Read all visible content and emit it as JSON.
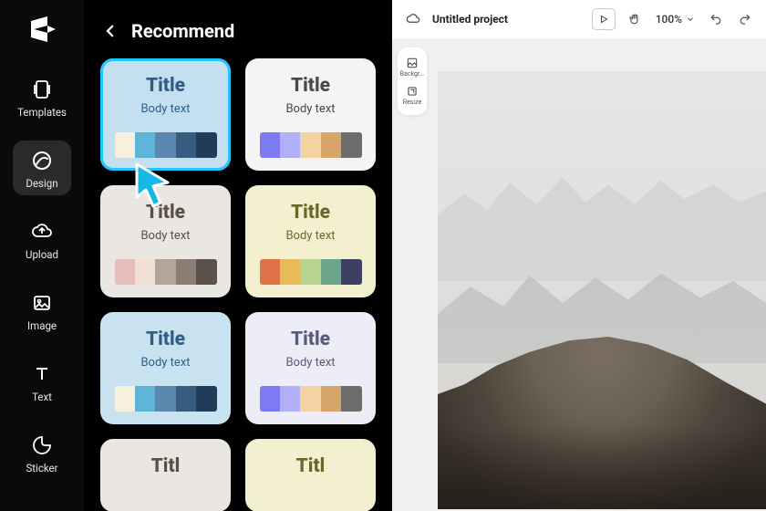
{
  "sidebar": {
    "items": [
      {
        "label": "Templates"
      },
      {
        "label": "Design"
      },
      {
        "label": "Upload"
      },
      {
        "label": "Image"
      },
      {
        "label": "Text"
      },
      {
        "label": "Sticker"
      }
    ]
  },
  "panel": {
    "title": "Recommend",
    "cards": [
      {
        "title": "Title",
        "body": "Body text",
        "bg": "#c4dfef",
        "title_color": "#2f5d87",
        "body_color": "#2f5d87",
        "swatches": [
          "#f6efdb",
          "#5eb3d8",
          "#5a87ae",
          "#385c7d",
          "#1f3d58"
        ]
      },
      {
        "title": "Title",
        "body": "Body text",
        "bg": "#f4f4f4",
        "title_color": "#4a4846",
        "body_color": "#4a4846",
        "swatches": [
          "#7d7af5",
          "#b2b0f9",
          "#f3d2a4",
          "#d6a56a",
          "#6c6d6a"
        ]
      },
      {
        "title": "Title",
        "body": "Body text",
        "bg": "#eae6e2",
        "title_color": "#5b4f48",
        "body_color": "#5b4f48",
        "swatches": [
          "#e6bcbd",
          "#f0dfd4",
          "#b2a59c",
          "#8a7d74",
          "#5d524a"
        ]
      },
      {
        "title": "Title",
        "body": "Body text",
        "bg": "#f3f0cf",
        "title_color": "#6a672e",
        "body_color": "#6a672e",
        "swatches": [
          "#de7348",
          "#e9bb58",
          "#b9d191",
          "#6ba68a",
          "#3e4063"
        ]
      },
      {
        "title": "Title",
        "body": "Body text",
        "bg": "#c9e2f0",
        "title_color": "#2f5d87",
        "body_color": "#2f5d87",
        "swatches": [
          "#f6efdb",
          "#5eb3d8",
          "#5a87ae",
          "#385c7d",
          "#1f3d58"
        ]
      },
      {
        "title": "Title",
        "body": "Body text",
        "bg": "#ecedf7",
        "title_color": "#5a5a7a",
        "body_color": "#5a5a7a",
        "swatches": [
          "#7d7af5",
          "#b2b0f9",
          "#f3d2a4",
          "#d6a56a",
          "#6c6d6a"
        ]
      },
      {
        "title": "Titl",
        "body": "",
        "bg": "#eae6e2",
        "title_color": "#5b4f48",
        "body_color": "#5b4f48",
        "swatches": []
      },
      {
        "title": "Titl",
        "body": "",
        "bg": "#f3f0cf",
        "title_color": "#6a672e",
        "body_color": "#6a672e",
        "swatches": []
      }
    ]
  },
  "editor": {
    "project_name": "Untitled project",
    "zoom": "100%",
    "tools": [
      {
        "label": "Backgr..."
      },
      {
        "label": "Resize"
      }
    ]
  }
}
